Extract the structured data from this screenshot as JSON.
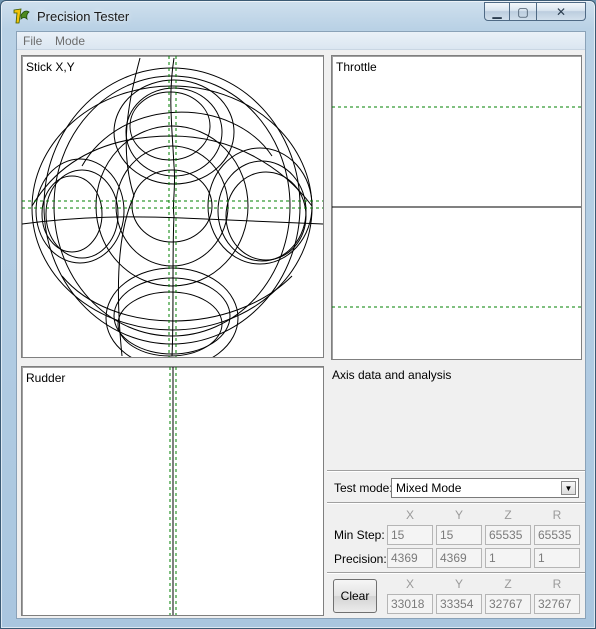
{
  "window": {
    "title": "Precision Tester",
    "controls": {
      "minimize": "▁",
      "maximize": "▢",
      "close": "✕"
    }
  },
  "menu": {
    "file": "File",
    "mode": "Mode"
  },
  "panels": {
    "stick": {
      "label": "Stick X,Y"
    },
    "throttle": {
      "label": "Throttle"
    },
    "rudder": {
      "label": "Rudder"
    },
    "analysis": {
      "label": "Axis data and analysis"
    }
  },
  "test_mode": {
    "label": "Test mode:",
    "value": "Mixed Mode"
  },
  "columns": [
    "X",
    "Y",
    "Z",
    "R"
  ],
  "min_step": {
    "label": "Min Step:",
    "values": [
      "15",
      "15",
      "65535",
      "65535"
    ]
  },
  "precision": {
    "label": "Precision:",
    "values": [
      "4369",
      "4369",
      "1",
      "1"
    ]
  },
  "current": {
    "button": "Clear",
    "values": [
      "33018",
      "33354",
      "32767",
      "32767"
    ]
  },
  "colors": {
    "guide": "#008000",
    "trace": "#000000",
    "panel_bg": "#ffffff"
  }
}
